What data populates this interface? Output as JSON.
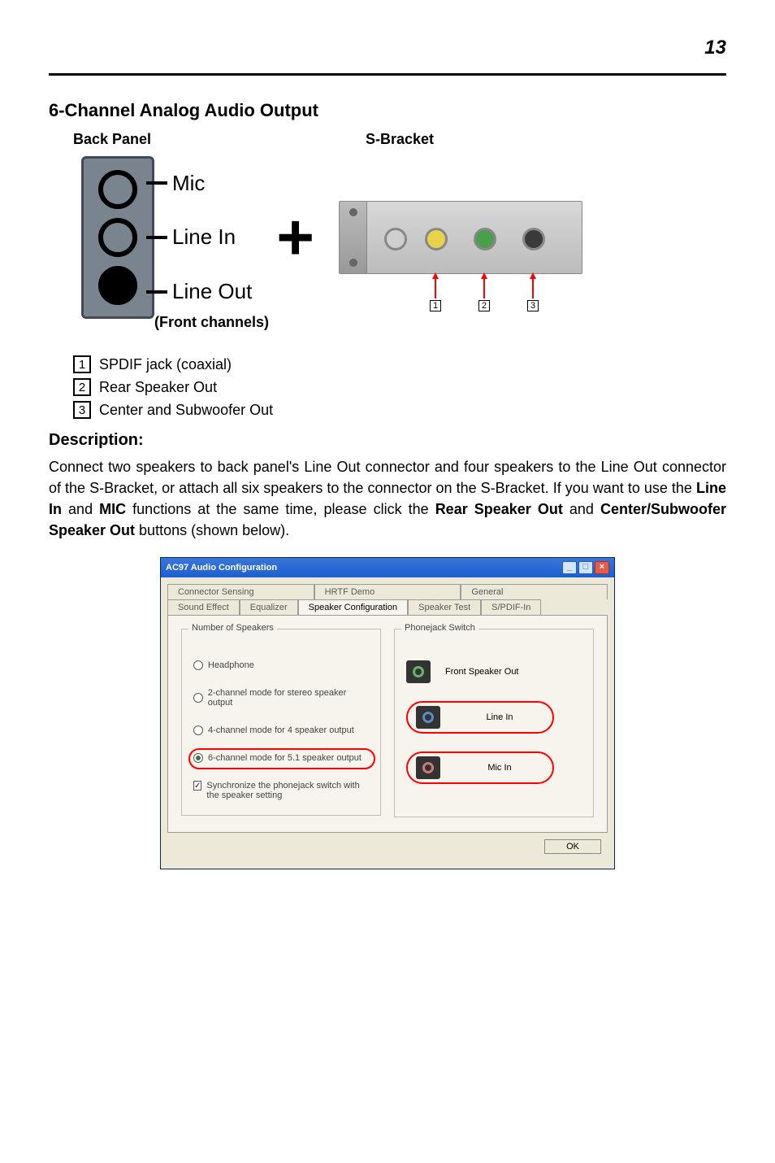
{
  "page_number": "13",
  "section_title": "6-Channel Analog Audio Output",
  "labels": {
    "back_panel": "Back Panel",
    "s_bracket": "S-Bracket",
    "mic": "Mic",
    "line_in": "Line In",
    "line_out": "Line Out",
    "front_channels": "(Front channels)"
  },
  "sbracket_items": [
    {
      "num": "1",
      "text": "SPDIF jack (coaxial)"
    },
    {
      "num": "2",
      "text": "Rear Speaker Out"
    },
    {
      "num": "3",
      "text": "Center and Subwoofer Out"
    }
  ],
  "description_heading": "Description:",
  "description_text": "Connect two speakers to back panel's Line Out connector and four speakers to the Line Out connector of the S-Bracket, or attach all six speakers to the connector on the S-Bracket. If you want to use the Line In and MIC functions at the same time, please click the Rear Speaker Out and Center/Subwoofer Speaker Out buttons (shown below).",
  "dialog": {
    "title": "AC97 Audio Configuration",
    "tabs_back": [
      "Connector Sensing",
      "HRTF Demo",
      "General"
    ],
    "tabs_front": [
      "Sound Effect",
      "Equalizer",
      "Speaker Configuration",
      "Speaker Test",
      "S/PDIF-In"
    ],
    "active_tab": "Speaker Configuration",
    "group_left_title": "Number of Speakers",
    "group_right_title": "Phonejack Switch",
    "radios": [
      {
        "label": "Headphone",
        "checked": false
      },
      {
        "label": "2-channel mode for stereo speaker output",
        "checked": false
      },
      {
        "label": "4-channel mode for 4 speaker output",
        "checked": false
      },
      {
        "label": "6-channel mode for 5.1 speaker output",
        "checked": true
      }
    ],
    "checkbox": {
      "label": "Synchronize the phonejack switch with the speaker setting",
      "checked": true
    },
    "phonejacks": [
      {
        "label": "Front Speaker Out",
        "color": "green",
        "highlight": false
      },
      {
        "label": "Line In",
        "color": "blue",
        "highlight": true
      },
      {
        "label": "Mic In",
        "color": "pink",
        "highlight": true
      }
    ],
    "ok": "OK"
  }
}
